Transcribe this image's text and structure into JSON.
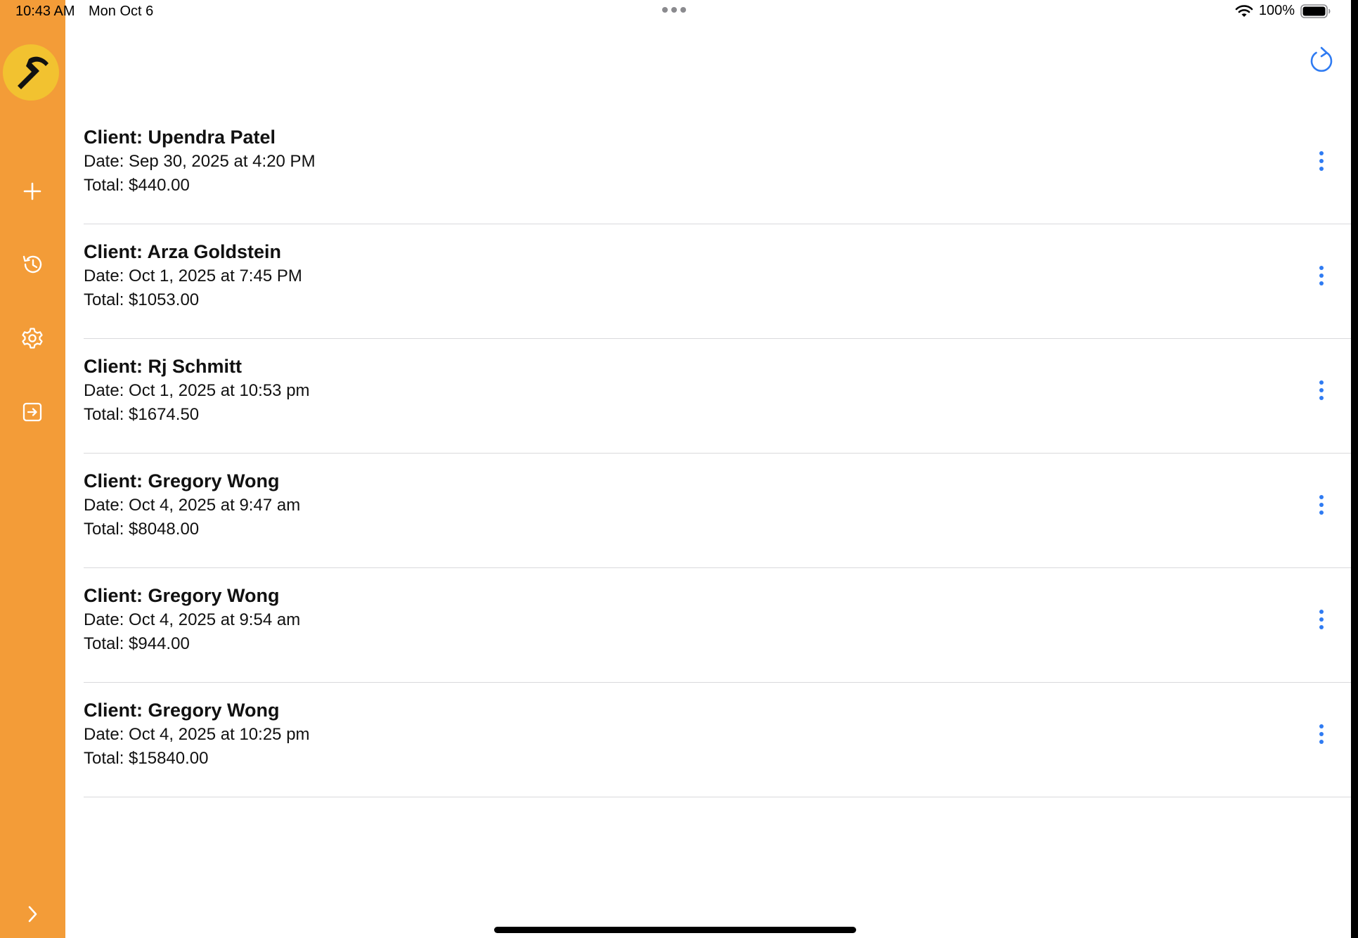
{
  "status_bar": {
    "time": "10:43 AM",
    "date": "Mon Oct 6",
    "battery": "100%"
  },
  "sidebar": {
    "logo_icon": "hammer-icon",
    "items": [
      {
        "icon": "plus-icon",
        "name": "new"
      },
      {
        "icon": "history-icon",
        "name": "history"
      },
      {
        "icon": "gear-icon",
        "name": "settings"
      },
      {
        "icon": "sign-out-icon",
        "name": "sign-out"
      }
    ],
    "expand_icon": "chevron-right-icon",
    "color": "#f39c38"
  },
  "toolbar": {
    "refresh_icon": "refresh-icon",
    "accent": "#2f7bf2"
  },
  "estimates": [
    {
      "client": "Client: Upendra Patel",
      "date": "Date: Sep 30, 2025 at 4:20 PM",
      "total": "Total: $440.00"
    },
    {
      "client": "Client: Arza Goldstein",
      "date": "Date: Oct 1, 2025 at 7:45 PM",
      "total": "Total: $1053.00"
    },
    {
      "client": "Client: Rj Schmitt",
      "date": "Date: Oct 1, 2025 at 10:53 pm",
      "total": "Total: $1674.50"
    },
    {
      "client": "Client: Gregory Wong",
      "date": "Date: Oct 4, 2025 at 9:47 am",
      "total": "Total: $8048.00"
    },
    {
      "client": "Client: Gregory Wong",
      "date": "Date: Oct 4, 2025 at 9:54 am",
      "total": "Total: $944.00"
    },
    {
      "client": "Client: Gregory Wong",
      "date": "Date: Oct 4, 2025 at 10:25 pm",
      "total": "Total: $15840.00"
    }
  ]
}
